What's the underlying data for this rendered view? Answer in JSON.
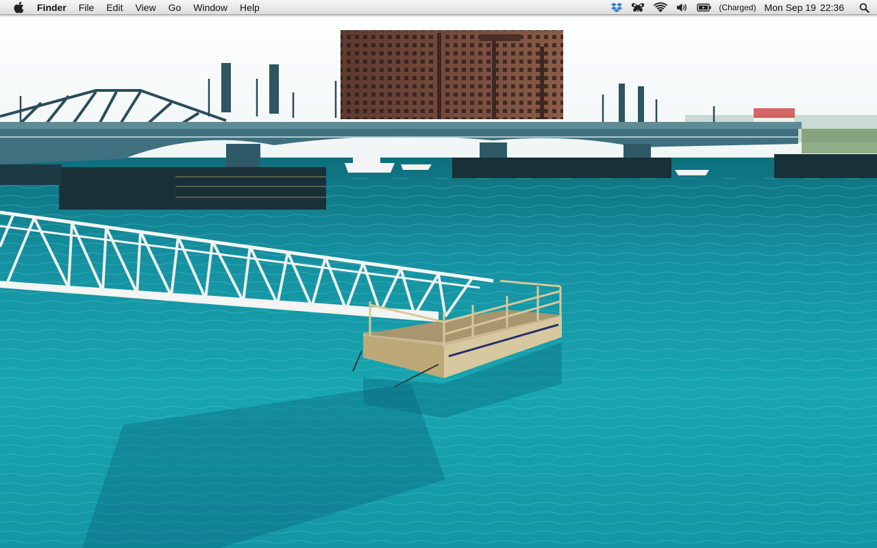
{
  "menubar": {
    "apple_icon": "apple-logo-icon",
    "app_name": "Finder",
    "menus": [
      "File",
      "Edit",
      "View",
      "Go",
      "Window",
      "Help"
    ],
    "status_icons": [
      "dropbox-icon",
      "butterfly-icon",
      "wifi-icon",
      "volume-icon",
      "battery-icon"
    ],
    "battery_status": "(Charged)",
    "clock": {
      "date": "Mon Sep 19",
      "time": "22:36"
    },
    "spotlight_icon": "search-icon"
  },
  "wallpaper": {
    "water_color": "#1aa3ad",
    "sky_color": "#f4f8f8",
    "building_color": "#7a5040",
    "bridge_color": "#3e6e7a"
  }
}
